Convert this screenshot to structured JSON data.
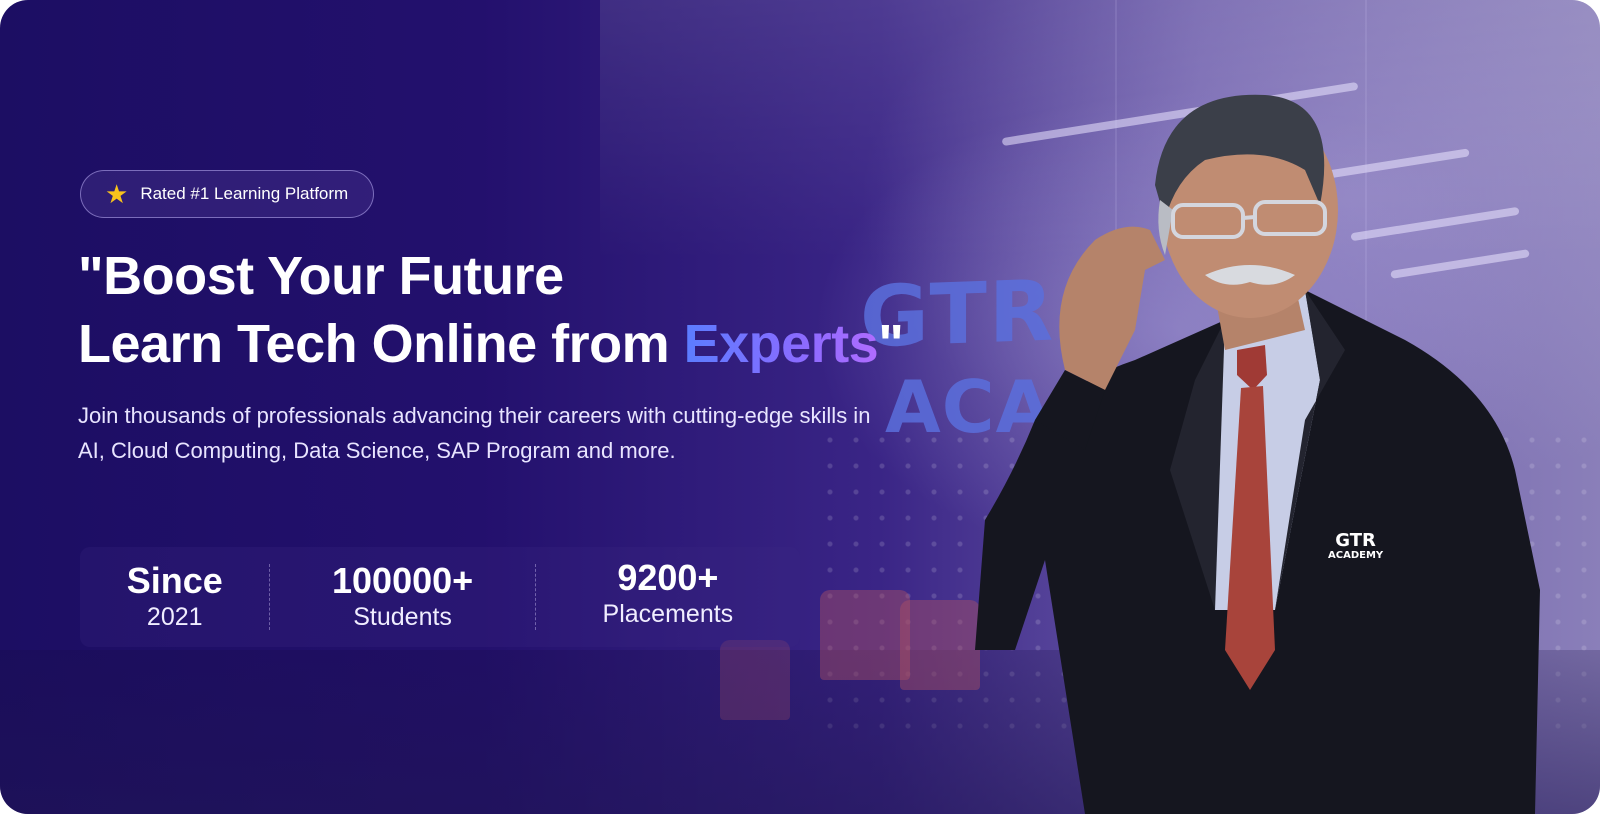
{
  "badge": {
    "icon": "star-icon",
    "label": "Rated #1 Learning Platform",
    "icon_color": "#f8c21c"
  },
  "headline": {
    "line1": "\"Boost Your Future",
    "line2_prefix": "Learn Tech Online from ",
    "line2_accent": "Experts",
    "line2_suffix": "\""
  },
  "subtext": "Join thousands of professionals advancing their careers with cutting-edge skills in AI, Cloud Computing, Data Science, SAP Program and more.",
  "stats": [
    {
      "value": "Since",
      "label": "2021"
    },
    {
      "value": "100000+",
      "label": "Students"
    },
    {
      "value": "9200+",
      "label": "Placements"
    }
  ],
  "background_sign": {
    "line1": "GTR",
    "line2": "ACA"
  },
  "badge_logo": {
    "line1": "GTR",
    "line2": "ACADEMY"
  },
  "colors": {
    "background_primary": "#1c0e63",
    "accent_gradient_start": "#5b7dff",
    "accent_gradient_end": "#b06cff",
    "text_primary": "#ffffff"
  }
}
